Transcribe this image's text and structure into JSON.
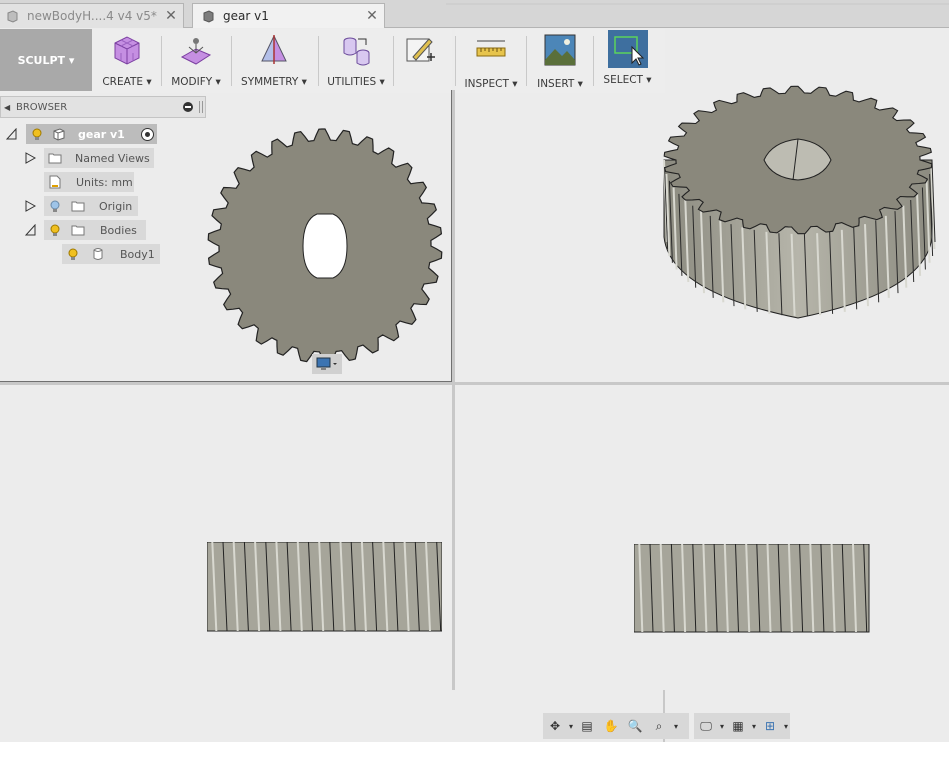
{
  "tabs": [
    {
      "label": "newBodyH....4 v4 v5*",
      "active": false
    },
    {
      "label": "gear v1",
      "active": true
    }
  ],
  "toolbar": {
    "workspace": "SCULPT",
    "groups": [
      {
        "label": "CREATE",
        "icon": "create-cube-icon"
      },
      {
        "label": "MODIFY",
        "icon": "modify-icon"
      },
      {
        "label": "SYMMETRY",
        "icon": "symmetry-icon"
      },
      {
        "label": "UTILITIES",
        "icon": "utilities-icon"
      },
      {
        "label": "",
        "icon": "edit-sketch-icon"
      },
      {
        "label": "INSPECT",
        "icon": "measure-ruler-icon"
      },
      {
        "label": "INSERT",
        "icon": "insert-image-icon"
      },
      {
        "label": "SELECT",
        "icon": "select-icon"
      }
    ]
  },
  "browser": {
    "title": "BROWSER",
    "tree": [
      {
        "label": "gear v1"
      },
      {
        "label": "Named Views"
      },
      {
        "label": "Units: mm"
      },
      {
        "label": "Origin"
      },
      {
        "label": "Bodies"
      },
      {
        "label": "Body1"
      }
    ]
  },
  "colors": {
    "gear_fill": "#8a887c",
    "gear_side": "#a7a69a",
    "ws_bg": "#a9a9a9",
    "select_bg": "#3e6f9f"
  }
}
